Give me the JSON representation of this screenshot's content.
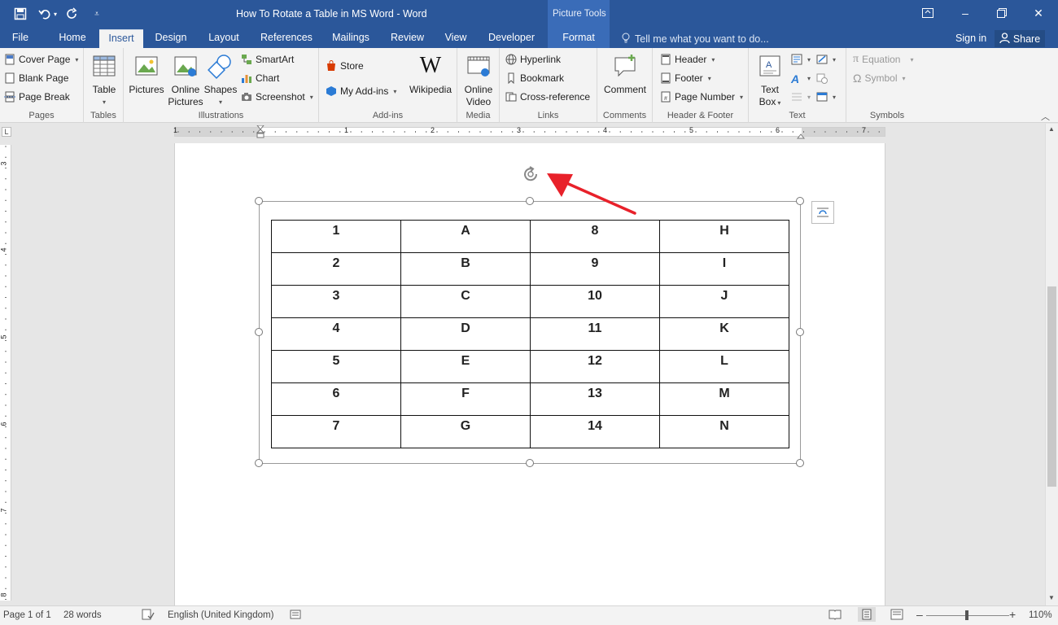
{
  "titlebar": {
    "title": "How To Rotate a Table in MS Word - Word",
    "contextual_group": "Picture Tools"
  },
  "tabs": {
    "file": "File",
    "home": "Home",
    "insert": "Insert",
    "design": "Design",
    "layout": "Layout",
    "references": "References",
    "mailings": "Mailings",
    "review": "Review",
    "view": "View",
    "developer": "Developer",
    "format": "Format",
    "tell_me": "Tell me what you want to do...",
    "sign_in": "Sign in",
    "share": "Share"
  },
  "ribbon": {
    "pages": {
      "label": "Pages",
      "cover_page": "Cover Page",
      "blank_page": "Blank Page",
      "page_break": "Page Break"
    },
    "tables": {
      "label": "Tables",
      "table": "Table"
    },
    "illustrations": {
      "label": "Illustrations",
      "pictures": "Pictures",
      "online_pictures_1": "Online",
      "online_pictures_2": "Pictures",
      "shapes": "Shapes",
      "smartart": "SmartArt",
      "chart": "Chart",
      "screenshot": "Screenshot"
    },
    "addins": {
      "label": "Add-ins",
      "store": "Store",
      "my_addins": "My Add-ins",
      "wikipedia": "Wikipedia"
    },
    "media": {
      "label": "Media",
      "online_video_1": "Online",
      "online_video_2": "Video"
    },
    "links": {
      "label": "Links",
      "hyperlink": "Hyperlink",
      "bookmark": "Bookmark",
      "cross_reference": "Cross-reference"
    },
    "comments": {
      "label": "Comments",
      "comment": "Comment"
    },
    "header_footer": {
      "label": "Header & Footer",
      "header": "Header",
      "footer": "Footer",
      "page_number": "Page Number"
    },
    "text": {
      "label": "Text",
      "text_box_1": "Text",
      "text_box_2": "Box"
    },
    "symbols": {
      "label": "Symbols",
      "equation": "Equation",
      "symbol": "Symbol"
    }
  },
  "ruler": {
    "corner": "L",
    "h_numbers": [
      "1",
      "1",
      "2",
      "3",
      "4",
      "5",
      "6",
      "7"
    ],
    "v_numbers": [
      "3",
      "4",
      "5",
      "6",
      "7",
      "8"
    ]
  },
  "table": {
    "rows": [
      [
        "1",
        "A",
        "8",
        "H"
      ],
      [
        "2",
        "B",
        "9",
        "I"
      ],
      [
        "3",
        "C",
        "10",
        "J"
      ],
      [
        "4",
        "D",
        "11",
        "K"
      ],
      [
        "5",
        "E",
        "12",
        "L"
      ],
      [
        "6",
        "F",
        "13",
        "M"
      ],
      [
        "7",
        "G",
        "14",
        "N"
      ]
    ]
  },
  "statusbar": {
    "page": "Page 1 of 1",
    "words": "28 words",
    "language": "English (United Kingdom)",
    "zoom": "110%"
  },
  "colors": {
    "brand": "#2b579a",
    "arrow": "#e8212a"
  }
}
